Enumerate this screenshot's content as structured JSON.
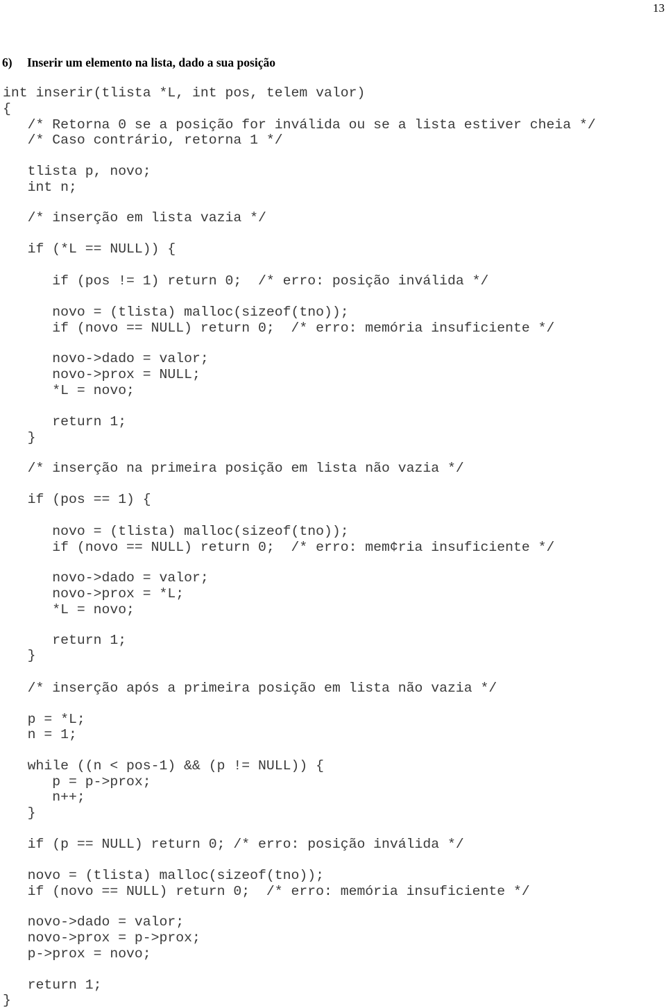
{
  "page": {
    "number": "13",
    "heading_number": "6)",
    "heading_title": "Inserir um elemento na lista, dado a sua posição"
  },
  "code": {
    "language": "C",
    "lines": [
      "int inserir(tlista *L, int pos, telem valor)",
      "{",
      "   /* Retorna 0 se a posição for inválida ou se a lista estiver cheia */",
      "   /* Caso contrário, retorna 1 */",
      "   tlista p, novo;",
      "   int n;",
      "   /* inserção em lista vazia */",
      "   if (*L == NULL)) {",
      "      if (pos != 1) return 0;  /* erro: posição inválida */",
      "      novo = (tlista) malloc(sizeof(tno));",
      "      if (novo == NULL) return 0;  /* erro: memória insuficiente */",
      "      novo->dado = valor;",
      "      novo->prox = NULL;",
      "      *L = novo;",
      "      return 1;",
      "   }",
      "   /* inserção na primeira posição em lista não vazia */",
      "   if (pos == 1) {",
      "      novo = (tlista) malloc(sizeof(tno));",
      "      if (novo == NULL) return 0;  /* erro: mem¢ria insuficiente */",
      "      novo->dado = valor;",
      "      novo->prox = *L;",
      "      *L = novo;",
      "      return 1;",
      "   }",
      "   /* inserção após a primeira posição em lista não vazia */",
      "   p = *L;",
      "   n = 1;",
      "   while ((n < pos-1) && (p != NULL)) {",
      "      p = p->prox;",
      "      n++;",
      "   }",
      "   if (p == NULL) return 0; /* erro: posição inválida */",
      "   novo = (tlista) malloc(sizeof(tno));",
      "   if (novo == NULL) return 0;  /* erro: memória insuficiente */",
      "   novo->dado = valor;",
      "   novo->prox = p->prox;",
      "   p->prox = novo;",
      "   return 1;",
      "}"
    ]
  }
}
